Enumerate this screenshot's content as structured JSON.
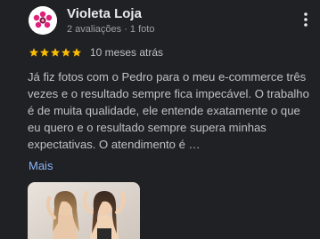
{
  "reviewer": {
    "name": "Violeta Loja",
    "meta": "2 avaliações · 1 foto"
  },
  "rating": {
    "stars": 5,
    "max": 5,
    "date": "10 meses atrás"
  },
  "review": {
    "text": "Já fiz fotos com o Pedro para o meu e-commerce três vezes e o resultado sempre fica impecável. O trabalho é de muita qualidade, ele entende exatamente o que eu quero e o resultado sempre supera minhas expectativas. O atendimento é …",
    "more_label": "Mais"
  },
  "colors": {
    "background": "#202124",
    "star": "#fbbc04",
    "link": "#8ab4f8",
    "avatar_brand": "#e0207a"
  },
  "icons": {
    "more_options": "more-vert-icon",
    "star": "star-icon",
    "avatar": "store-logo-icon"
  }
}
